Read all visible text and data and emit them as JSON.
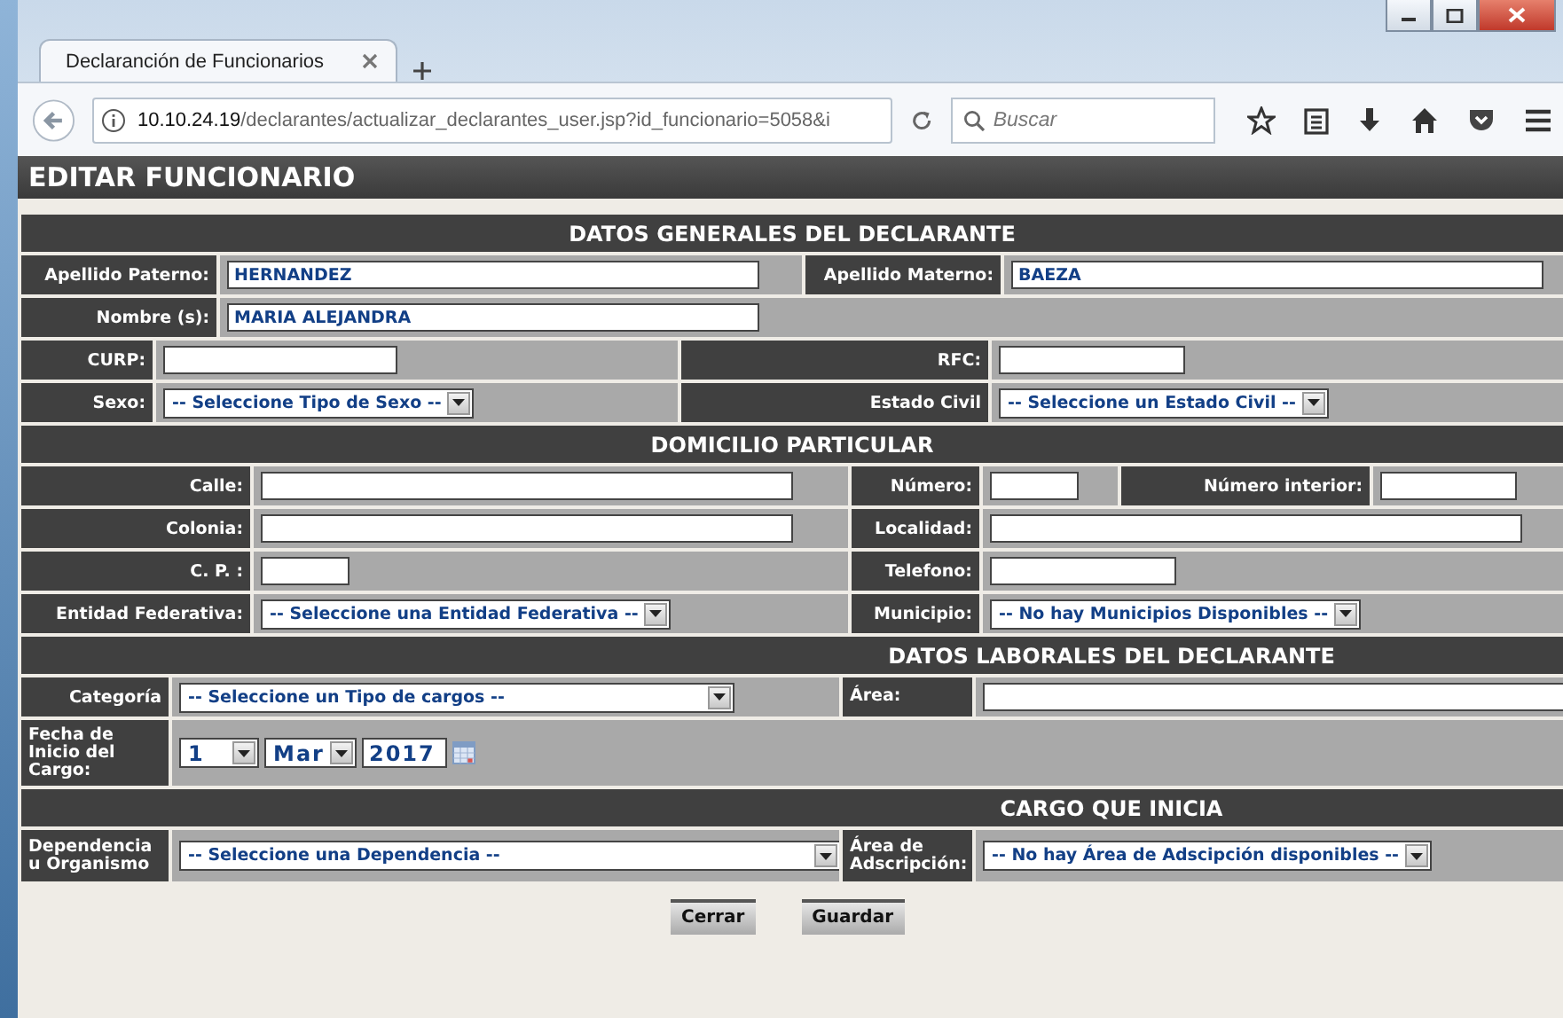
{
  "browser": {
    "tab_title": "Declaranción de Funcionarios",
    "url_host": "10.10.24.19",
    "url_path": "/declarantes/actualizar_declarantes_user.jsp?id_funcionario=5058&i",
    "search_placeholder": "Buscar"
  },
  "page_title": "EDITAR FUNCIONARIO",
  "sections": [
    {
      "title": "DATOS GENERALES DEL DECLARANTE",
      "rows": [
        [
          {
            "kind": "label",
            "text": "Apellido Paterno:"
          },
          {
            "kind": "text_field",
            "value": "HERNANDEZ"
          },
          {
            "kind": "label",
            "text": "Apellido Materno:"
          },
          {
            "kind": "text_field",
            "value": "BAEZA"
          }
        ],
        [
          {
            "kind": "label",
            "text": "Nombre (s):"
          },
          {
            "kind": "text_field",
            "value": "MARIA ALEJANDRA"
          }
        ],
        [
          {
            "kind": "label",
            "text": "CURP:"
          },
          {
            "kind": "text_field"
          },
          {
            "kind": "label",
            "text": "RFC:"
          },
          {
            "kind": "text_field"
          }
        ],
        [
          {
            "kind": "label",
            "text": "Sexo:"
          },
          {
            "kind": "dropdown",
            "value": "-- Seleccione Tipo de Sexo --"
          },
          {
            "kind": "label",
            "text": "Estado Civil"
          },
          {
            "kind": "dropdown",
            "value": "-- Seleccione un Estado Civil --"
          }
        ]
      ]
    },
    {
      "title": "DOMICILIO PARTICULAR",
      "rows": [
        [
          {
            "kind": "label",
            "text": "Calle:"
          },
          {
            "kind": "text_field"
          },
          {
            "kind": "label",
            "text": "Número:"
          },
          {
            "kind": "text_field"
          },
          {
            "kind": "label",
            "text": "Número interior:"
          },
          {
            "kind": "text_field"
          }
        ],
        [
          {
            "kind": "label",
            "text": "Colonia:"
          },
          {
            "kind": "text_field"
          },
          {
            "kind": "label",
            "text": "Localidad:"
          },
          {
            "kind": "text_field"
          }
        ],
        [
          {
            "kind": "label",
            "text": "C. P. :"
          },
          {
            "kind": "text_field"
          },
          {
            "kind": "label",
            "text": "Telefono:"
          },
          {
            "kind": "text_field"
          }
        ],
        [
          {
            "kind": "label",
            "text": "Entidad Federativa:"
          },
          {
            "kind": "dropdown",
            "value": "-- Seleccione una Entidad Federativa --"
          },
          {
            "kind": "label",
            "text": "Municipio:"
          },
          {
            "kind": "dropdown",
            "value": "-- No hay Municipios Disponibles --"
          }
        ]
      ]
    },
    {
      "title": "DATOS LABORALES DEL DECLARANTE",
      "rows": [
        [
          {
            "kind": "label",
            "text": "Categoría"
          },
          {
            "kind": "dropdown",
            "value": "-- Seleccione un Tipo de cargos --"
          },
          {
            "kind": "label",
            "text": "Área:"
          },
          {
            "kind": "text_field"
          }
        ],
        [
          {
            "kind": "label",
            "text": "Fecha de Inicio del Cargo:"
          },
          {
            "kind": "date",
            "day": "1",
            "month": "Mar",
            "year": "2017"
          }
        ]
      ]
    },
    {
      "title": "CARGO QUE INICIA",
      "rows": [
        [
          {
            "kind": "label",
            "text": "Dependencia u Organismo"
          },
          {
            "kind": "dropdown",
            "value": "-- Seleccione una Dependencia --"
          },
          {
            "kind": "label",
            "text": "Área de Adscripción:"
          },
          {
            "kind": "dropdown",
            "value": "-- No hay Área de Adscipción disponibles --"
          }
        ]
      ]
    }
  ],
  "buttons": [
    {
      "label": "Cerrar"
    },
    {
      "label": "Guardar"
    }
  ]
}
